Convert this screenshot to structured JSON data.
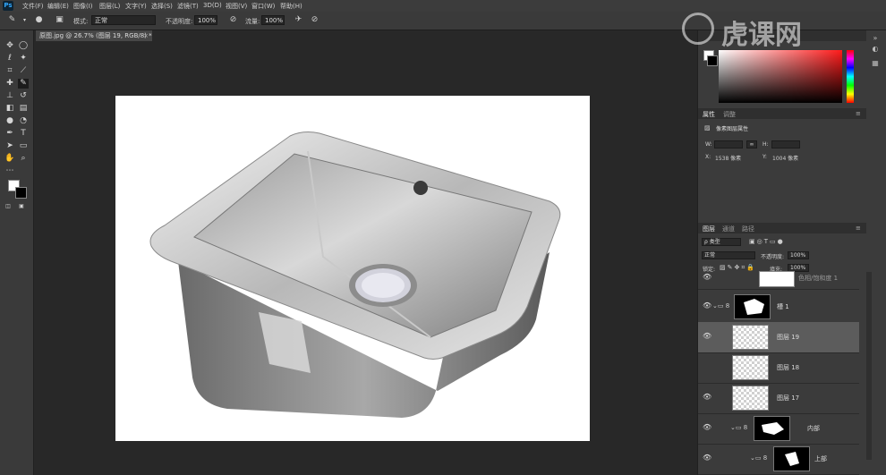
{
  "app": {
    "logo": "Ps"
  },
  "menu": [
    "文件(F)",
    "编辑(E)",
    "图像(I)",
    "图层(L)",
    "文字(Y)",
    "选择(S)",
    "滤镜(T)",
    "3D(D)",
    "视图(V)",
    "窗口(W)",
    "帮助(H)"
  ],
  "options": {
    "mode_label": "模式:",
    "mode_value": "正常",
    "opacity_label": "不透明度:",
    "opacity_value": "100%",
    "flow_label": "流量:",
    "flow_value": "100%"
  },
  "document": {
    "tab_title": "原图.jpg @ 26.7% (图层 19, RGB/8) *",
    "tab_close": "×"
  },
  "properties": {
    "tab_properties": "属性",
    "tab_adjustments": "调整",
    "title": "像素图层属性",
    "w_label": "W:",
    "h_label": "H:",
    "x_label": "X:",
    "x_value": "1538 像素",
    "y_label": "Y:",
    "y_value": "1004 像素",
    "link_icon": "chain-icon"
  },
  "layers_panel": {
    "tabs": [
      "图层",
      "通道",
      "路径"
    ],
    "filter_kind": "ρ 类型",
    "blend_mode": "正常",
    "opacity_label": "不透明度:",
    "opacity_value": "100%",
    "lock_label": "锁定:",
    "fill_label": "填充:",
    "fill_value": "100%",
    "layers": [
      {
        "name": "色相/饱和度 1",
        "type": "adjustment"
      },
      {
        "name": "槽 1",
        "type": "group"
      },
      {
        "name": "图层 19",
        "type": "pixel"
      },
      {
        "name": "图层 18",
        "type": "pixel"
      },
      {
        "name": "图层 17",
        "type": "pixel"
      },
      {
        "name": "内部",
        "type": "group"
      },
      {
        "name": "上部",
        "type": "group"
      }
    ]
  },
  "watermark": {
    "brand": "虎课网"
  },
  "colors": {
    "accent": "#31a8ff",
    "panel_bg": "#3b3b3b",
    "canvas_bg": "#282828"
  }
}
